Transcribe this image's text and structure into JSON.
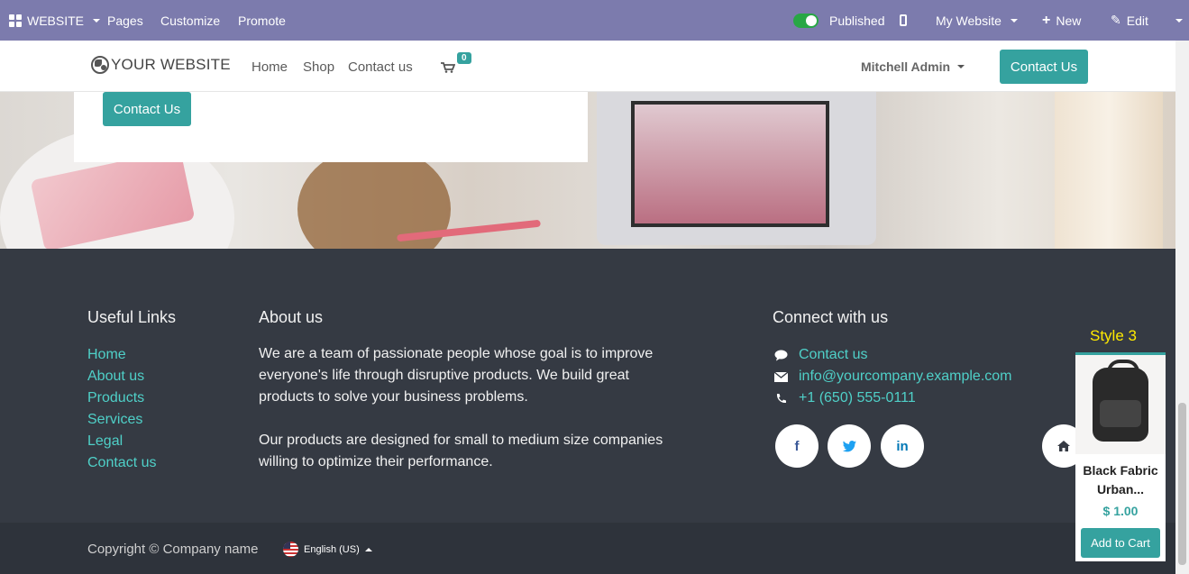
{
  "adminbar": {
    "app_menu": "WEBSITE",
    "pages": "Pages",
    "customize": "Customize",
    "promote": "Promote",
    "published": "Published",
    "website_selector": "My Website",
    "new": "New",
    "edit": "Edit"
  },
  "header": {
    "logo": "YOUR WEBSITE",
    "nav": [
      "Home",
      "Shop",
      "Contact us"
    ],
    "cart_count": "0",
    "user": "Mitchell Admin",
    "cta": "Contact Us"
  },
  "hero": {
    "cta": "Contact Us"
  },
  "footer": {
    "useful_links_title": "Useful Links",
    "useful_links": [
      "Home",
      "About us",
      "Products",
      "Services",
      "Legal",
      "Contact us"
    ],
    "about_title": "About us",
    "about_p1": "We are a team of passionate people whose goal is to improve everyone's life through disruptive products. We build great products to solve your business problems.",
    "about_p2": "Our products are designed for small to medium size companies willing to optimize their performance.",
    "connect_title": "Connect with us",
    "contact": [
      "Contact us",
      "info@yourcompany.example.com",
      "+1 (650) 555-0111"
    ],
    "copyright": "Copyright © Company name",
    "language": "English (US)"
  },
  "widget": {
    "label": "Style 3",
    "product_name": "Black Fabric Urban...",
    "price": "$ 1.00",
    "add_to_cart": "Add to Cart"
  },
  "colors": {
    "adminbar": "#7c7bad",
    "accent": "#35a29f",
    "link": "#4fd0c8",
    "footer": "#353a43"
  }
}
